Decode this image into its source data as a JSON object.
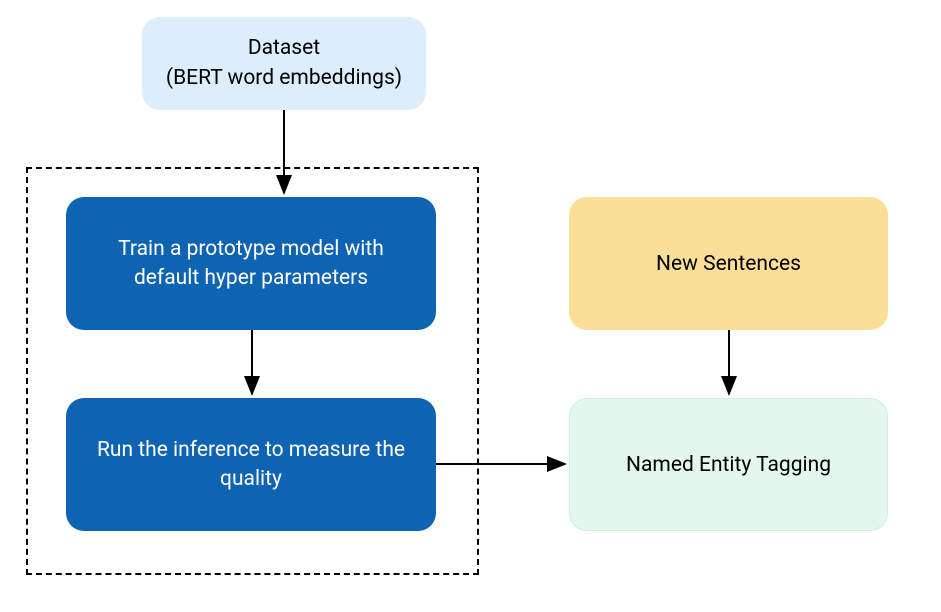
{
  "boxes": {
    "dataset": {
      "line1": "Dataset",
      "line2": "(BERT word embeddings)"
    },
    "train": "Train a prototype model with default hyper parameters",
    "inference": "Run the inference to measure the quality",
    "newSentences": "New Sentences",
    "tagging": "Named Entity Tagging"
  },
  "colors": {
    "datasetBg": "#dcedfb",
    "blueBg": "#0e63b2",
    "yellowBg": "#fbdf96",
    "greenBg": "#e4f7ec"
  }
}
